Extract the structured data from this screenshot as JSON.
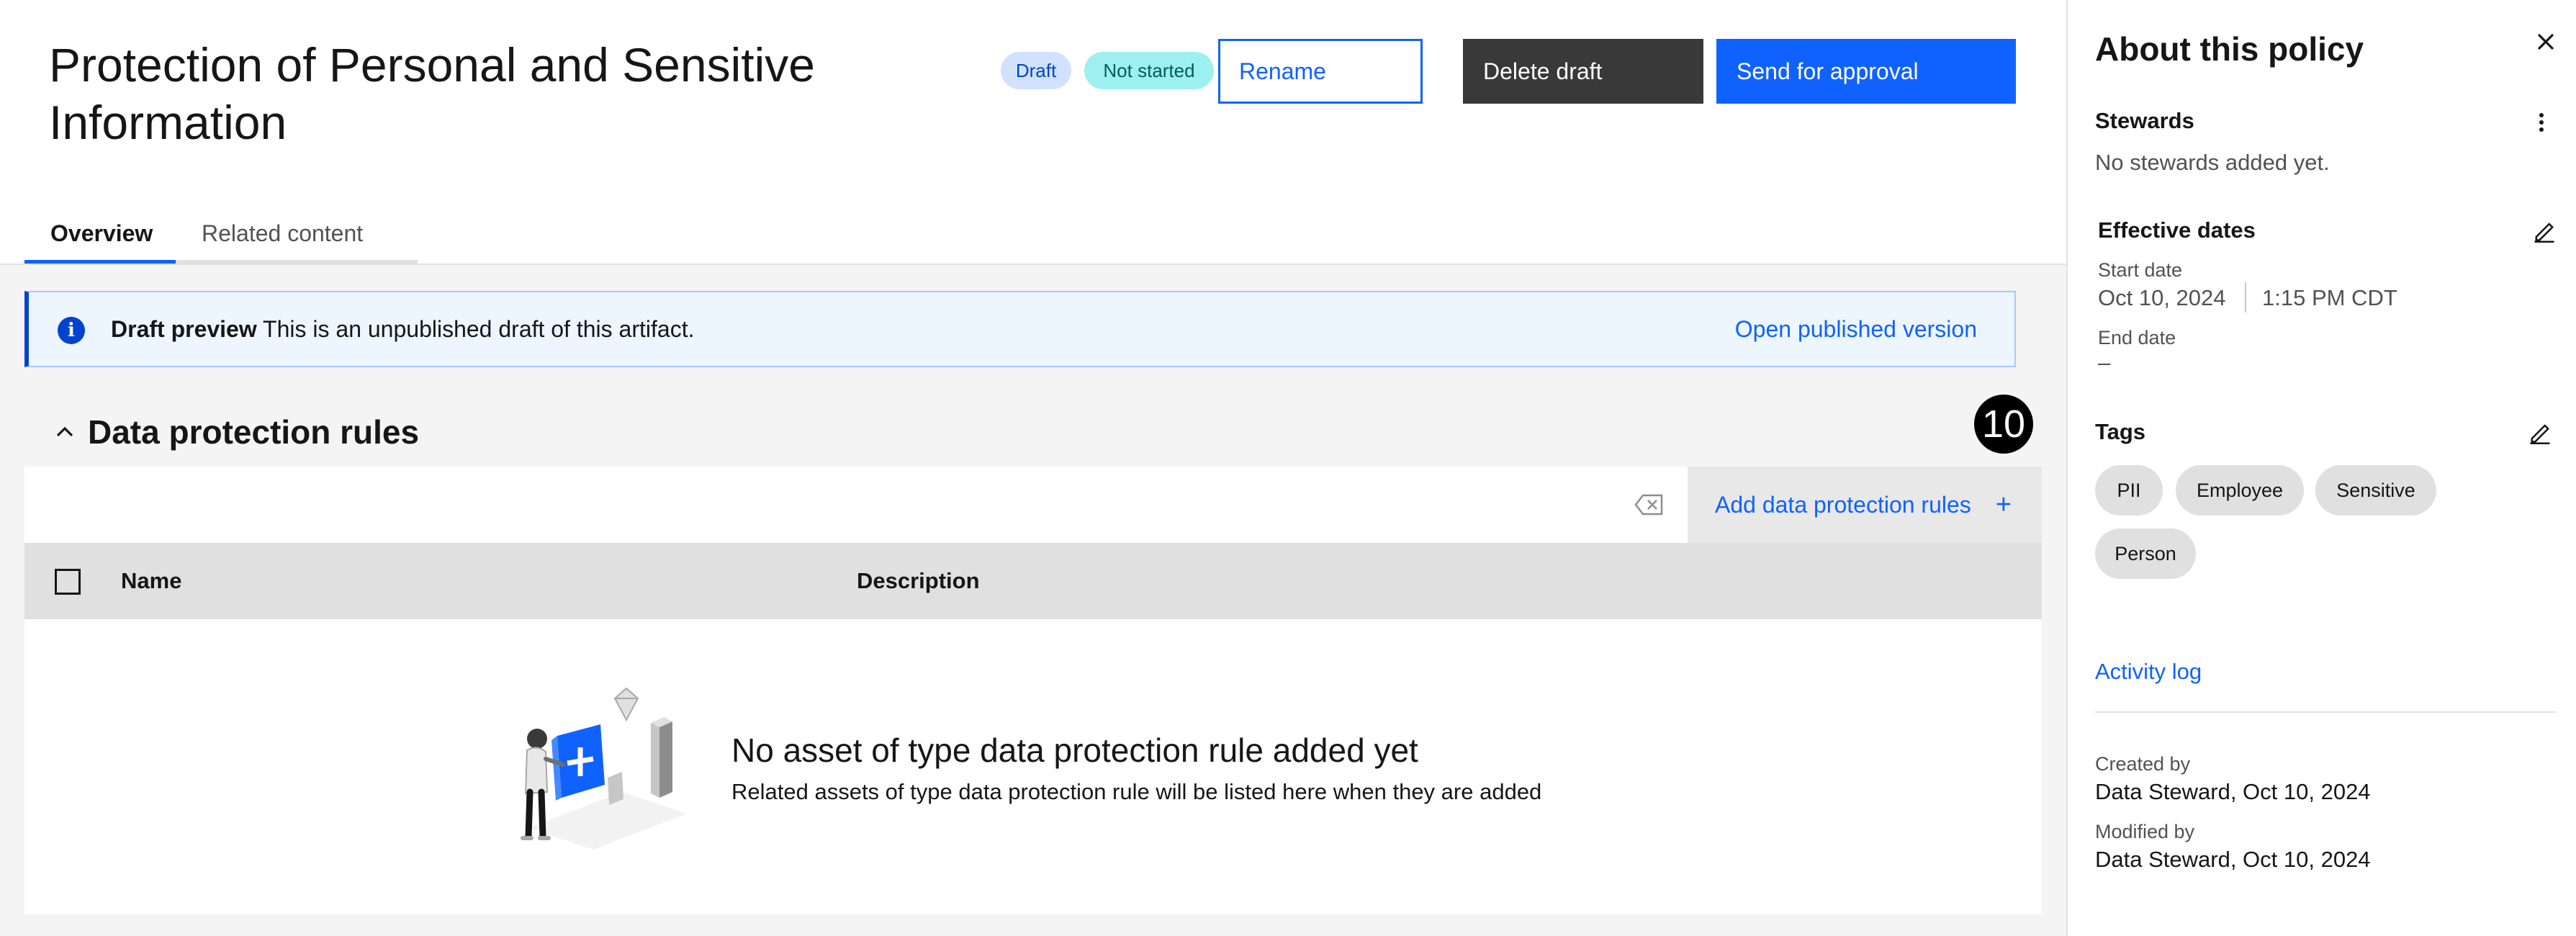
{
  "header": {
    "title": "Protection of Personal and Sensitive Information",
    "tags": {
      "draft": "Draft",
      "status": "Not started"
    },
    "buttons": {
      "rename": "Rename",
      "delete": "Delete draft",
      "send": "Send for approval"
    }
  },
  "tabs": [
    {
      "label": "Overview",
      "selected": true
    },
    {
      "label": "Related content",
      "selected": false
    }
  ],
  "notification": {
    "title": "Draft preview",
    "message": "This is an unpublished draft of this artifact.",
    "link": "Open published version",
    "icon": "info-icon"
  },
  "section": {
    "title": "Data protection rules",
    "count": "10",
    "add_button": "Add data protection rules",
    "add_icon": "+",
    "table": {
      "columns": [
        "Name",
        "Description"
      ],
      "rows": []
    },
    "empty_state": {
      "title": "No asset of type data protection rule added yet",
      "subtitle": "Related assets of type data protection rule will be listed here when they are added"
    }
  },
  "panel": {
    "title": "About this policy",
    "stewards": {
      "label": "Stewards",
      "empty": "No stewards added yet."
    },
    "effective_dates": {
      "label": "Effective dates",
      "start_label": "Start date",
      "start_date": "Oct 10, 2024",
      "start_time": "1:15 PM CDT",
      "end_label": "End date",
      "end_value": "–"
    },
    "tags": {
      "label": "Tags",
      "items": [
        "PII",
        "Employee",
        "Sensitive",
        "Person"
      ]
    },
    "activity_log": "Activity log",
    "created": {
      "label": "Created by",
      "value": "Data Steward, Oct 10, 2024"
    },
    "modified": {
      "label": "Modified by",
      "value": "Data Steward, Oct 10, 2024"
    }
  },
  "colors": {
    "primary": "#0f62fe",
    "delete_button": "#393939",
    "draft_tag": "#d0e2ff",
    "status_tag": "#9ef0f0",
    "notification_bg": "#edf5ff"
  }
}
